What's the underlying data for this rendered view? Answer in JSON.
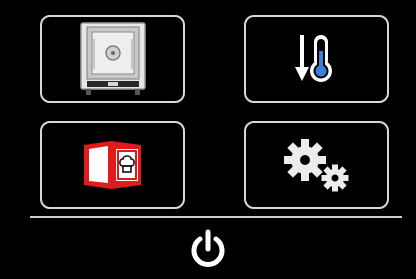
{
  "tiles": [
    {
      "name": "oven",
      "icon": "oven-icon"
    },
    {
      "name": "temperature",
      "icon": "thermometer-arrow-down-icon"
    },
    {
      "name": "recipes",
      "icon": "recipe-book-chef-icon"
    },
    {
      "name": "settings",
      "icon": "gears-icon"
    }
  ],
  "power": {
    "icon": "power-icon"
  },
  "colors": {
    "background": "#000000",
    "tile_border": "#d8d8d8",
    "accent_blue": "#3d7fd6",
    "recipe_red": "#e01b1b"
  }
}
